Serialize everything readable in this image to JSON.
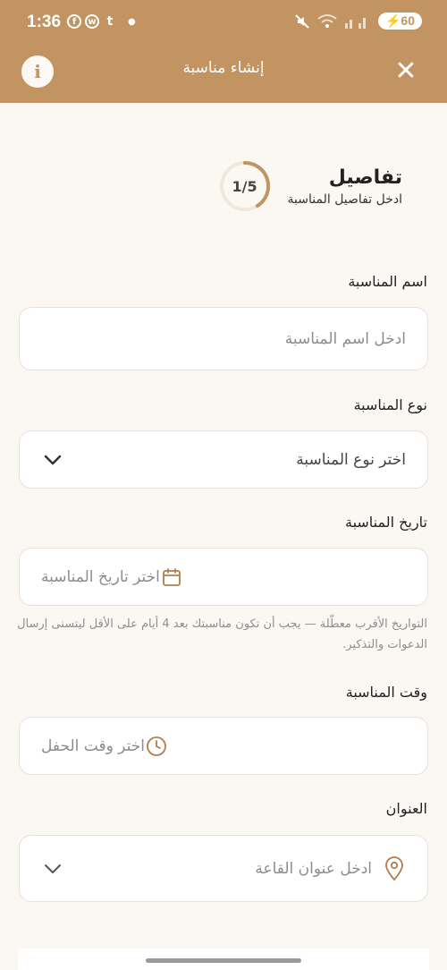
{
  "status_bar": {
    "time": "1:36",
    "battery": "60",
    "apps": [
      "f",
      "w",
      "t"
    ]
  },
  "app_bar": {
    "title": "إنشاء مناسبة",
    "info_icon": "i",
    "close_icon": "✕"
  },
  "step": {
    "progress": "1/5",
    "title": "تفاصيل",
    "subtitle": "ادخل تفاصيل المناسبة"
  },
  "form": {
    "event_name": {
      "label": "اسم المناسبة",
      "placeholder": "ادخل اسم المناسبة"
    },
    "event_type": {
      "label": "نوع المناسبة",
      "placeholder": "اختر نوع المناسبة",
      "icon": "chevron-down-icon"
    },
    "event_date": {
      "label": "تاريخ المناسبة",
      "placeholder": "اختر تاريخ المناسبة",
      "icon": "calendar-icon",
      "helper": "التواريخ الأقرب معطّلة — يجب أن تكون مناسبتك بعد 4 أيام على الأقل ليتسنى إرسال الدعوات والتذكير."
    },
    "event_time": {
      "label": "وقت المناسبة",
      "placeholder": "اختر وقت الحفل",
      "icon": "clock-icon"
    },
    "address": {
      "label": "العنوان",
      "placeholder": "ادخل عنوان القاعة",
      "icon": "location-pin-icon",
      "trail_icon": "chevron-down-icon"
    }
  },
  "colors": {
    "primary": "#c29461",
    "background": "#fbf8f4",
    "field_border": "#e6e1dc",
    "placeholder": "#8d8d8d"
  }
}
